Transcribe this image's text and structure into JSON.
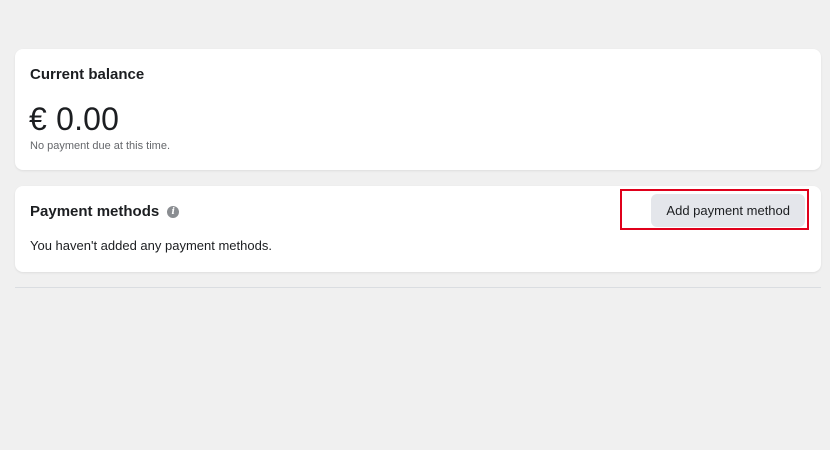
{
  "balance": {
    "title": "Current balance",
    "amount": "€ 0.00",
    "note": "No payment due at this time."
  },
  "payment_methods": {
    "title": "Payment methods",
    "info_icon": "info-icon",
    "empty_message": "You haven't added any payment methods.",
    "add_button_label": "Add payment method"
  },
  "colors": {
    "background": "#f0f0f0",
    "card": "#ffffff",
    "button_bg": "#e4e6eb",
    "highlight": "#e0001b"
  }
}
